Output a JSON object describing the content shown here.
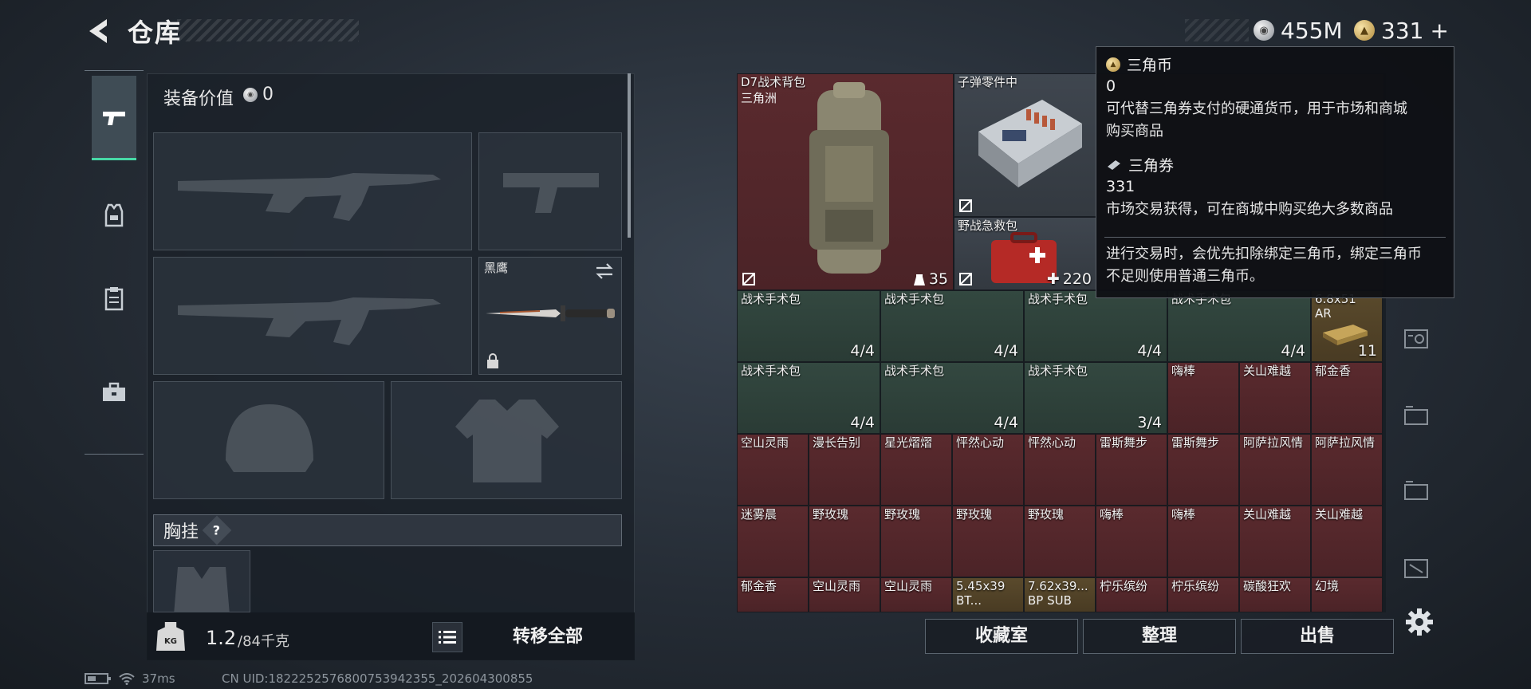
{
  "header": {
    "title": "仓库",
    "currency": [
      {
        "kind": "silver",
        "value": "455M"
      },
      {
        "kind": "gold",
        "value": "331",
        "plus": "+"
      }
    ]
  },
  "side_tabs": [
    {
      "name": "weapons",
      "icon": "pistol-icon",
      "active": true
    },
    {
      "name": "armor",
      "icon": "vest-icon",
      "active": false
    },
    {
      "name": "clipboard",
      "icon": "clipboard-icon",
      "active": false
    },
    {
      "name": "toolbox",
      "icon": "toolbox-icon",
      "active": false
    }
  ],
  "left": {
    "equip_value_label": "装备价值",
    "equip_value": "0",
    "melee_name": "黑鹰",
    "chest_rig_label": "胸挂",
    "help": "?",
    "weight_icon_text": "KG",
    "weight_current": "1.2",
    "weight_unit": "/84千克",
    "transfer_all": "转移全部"
  },
  "status": {
    "ping": "37ms",
    "uid": "CN UID:1822252576800753942355_202604300855"
  },
  "grid": {
    "backpack": {
      "name": "D7战术背包",
      "sub": "三角洲",
      "count": "35"
    },
    "ammo_parts": {
      "name": "子弹零件中"
    },
    "field_kit": {
      "name": "野战急救包",
      "count": "220"
    },
    "partial_ammo": {
      "name": "6.8x51",
      "sub": "AR",
      "count": "11"
    },
    "surgery_kits": [
      {
        "name": "战术手术包",
        "count": "4/4"
      },
      {
        "name": "战术手术包",
        "count": "4/4"
      },
      {
        "name": "战术手术包",
        "count": "4/4"
      },
      {
        "name": "战术手术包",
        "count": "4/4"
      },
      {
        "name": "战术手术包",
        "count": "4/4"
      },
      {
        "name": "战术手术包",
        "count": "4/4"
      },
      {
        "name": "战术手术包",
        "count": "3/4"
      }
    ],
    "row5_right": [
      {
        "name": "嗨棒"
      },
      {
        "name": "关山难越"
      },
      {
        "name": "郁金香"
      }
    ],
    "row6": [
      {
        "name": "空山灵雨"
      },
      {
        "name": "漫长告别"
      },
      {
        "name": "星光熠熠"
      },
      {
        "name": "怦然心动"
      },
      {
        "name": "怦然心动"
      },
      {
        "name": "雷斯舞步"
      },
      {
        "name": "雷斯舞步"
      },
      {
        "name": "阿萨拉风情"
      },
      {
        "name": "阿萨拉风情"
      }
    ],
    "row7": [
      {
        "name": "迷雾晨"
      },
      {
        "name": "野玫瑰"
      },
      {
        "name": "野玫瑰"
      },
      {
        "name": "野玫瑰"
      },
      {
        "name": "野玫瑰"
      },
      {
        "name": "嗨棒"
      },
      {
        "name": "嗨棒"
      },
      {
        "name": "关山难越"
      },
      {
        "name": "关山难越"
      }
    ],
    "row8": [
      {
        "name": "郁金香"
      },
      {
        "name": "空山灵雨"
      },
      {
        "name": "空山灵雨"
      },
      {
        "name": "5.45x39",
        "sub": "BT..."
      },
      {
        "name": "7.62x39...",
        "sub": "BP SUB"
      },
      {
        "name": "柠乐缤纷"
      },
      {
        "name": "柠乐缤纷"
      },
      {
        "name": "碳酸狂欢"
      },
      {
        "name": "幻境"
      }
    ]
  },
  "footer": {
    "collection": "收藏室",
    "sort": "整理",
    "sell": "出售"
  },
  "tooltip": {
    "coin_title": "三角币",
    "coin_value": "0",
    "coin_desc_1": "可代替三角券支付的硬通货币，用于市场和商城",
    "coin_desc_2": "购买商品",
    "ticket_title": "三角券",
    "ticket_value": "331",
    "ticket_desc": "市场交易获得，可在商城中购买绝大多数商品",
    "note_1": "进行交易时，会优先扣除绑定三角币，绑定三角币",
    "note_2": "不足则使用普通三角币。"
  },
  "colors": {
    "accent": "#47d9a6",
    "cell_red": "#5a2a2e",
    "cell_green": "#334840",
    "cell_gold": "#5a4a2c"
  }
}
